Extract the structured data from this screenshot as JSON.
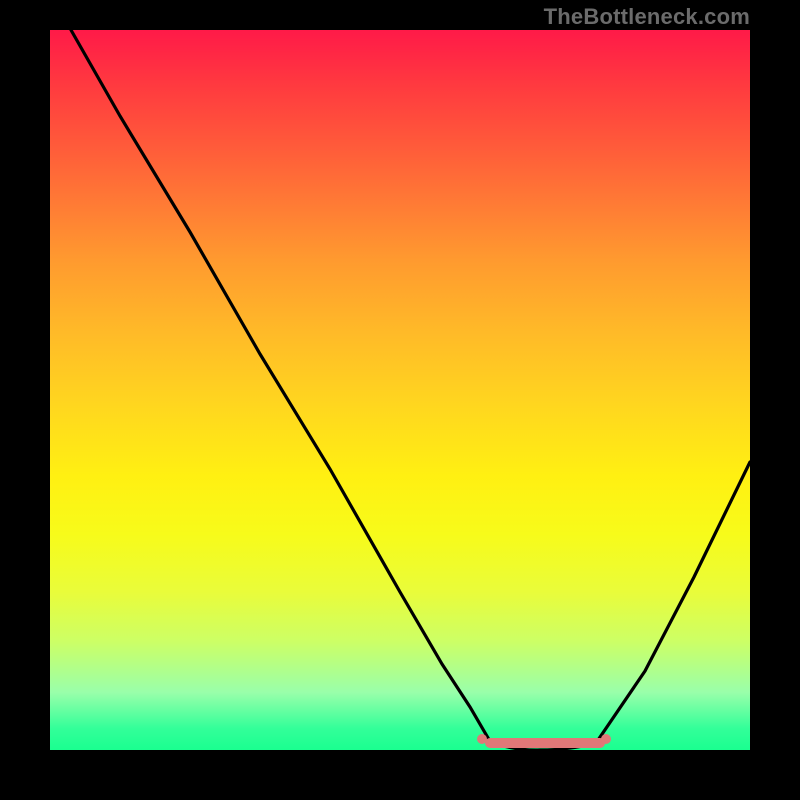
{
  "watermark": "TheBottleneck.com",
  "colors": {
    "background": "#000000",
    "curve": "#000000",
    "marker": "#e07878"
  },
  "chart_data": {
    "type": "line",
    "title": "",
    "xlabel": "",
    "ylabel": "",
    "xlim": [
      0,
      100
    ],
    "ylim": [
      0,
      100
    ],
    "grid": false,
    "legend": false,
    "note": "Values estimated from pixel positions; x and y are percentages of the visible gradient plot area (0 = left/bottom, 100 = right/top). The curve is a bottleneck/valley shape with its minimum plateau around x≈63–78.",
    "series": [
      {
        "name": "bottleneck-curve",
        "x": [
          3,
          10,
          20,
          30,
          40,
          50,
          56,
          60,
          63,
          70,
          78,
          85,
          92,
          100
        ],
        "y": [
          100,
          88,
          72,
          55,
          39,
          22,
          12,
          6,
          1,
          0,
          1,
          11,
          24,
          40
        ]
      }
    ],
    "markers": {
      "name": "optimal-range",
      "style": "rounded-salmon-segment",
      "x_range": [
        61,
        79
      ],
      "y": 1
    }
  }
}
